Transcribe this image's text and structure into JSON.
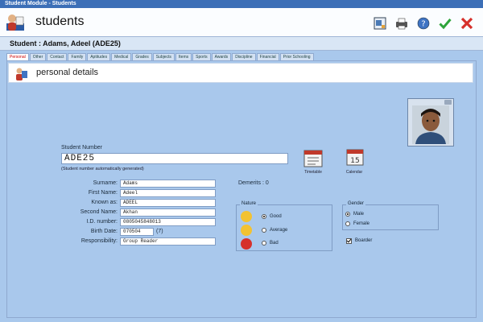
{
  "window": {
    "title": "Student Module - Students"
  },
  "header": {
    "title": "students"
  },
  "student": {
    "heading": "Student : Adams, Adeel (ADE25)"
  },
  "tabs": [
    {
      "label": "Personal"
    },
    {
      "label": "Other"
    },
    {
      "label": "Contact"
    },
    {
      "label": "Family"
    },
    {
      "label": "Aptitudes"
    },
    {
      "label": "Medical"
    },
    {
      "label": "Grades"
    },
    {
      "label": "Subjects"
    },
    {
      "label": "Items"
    },
    {
      "label": "Sports"
    },
    {
      "label": "Awards"
    },
    {
      "label": "Discipline"
    },
    {
      "label": "Financial"
    },
    {
      "label": "Prior Schooling"
    }
  ],
  "section": {
    "title": "personal details"
  },
  "student_number": {
    "label": "Student Number",
    "value": "ADE25",
    "hint": "(Student number automatically generated)"
  },
  "buttons": {
    "timetable": "Timetable",
    "calendar": "Calendar"
  },
  "fields": [
    {
      "label": "Surname:",
      "value": "Adams"
    },
    {
      "label": "First Name:",
      "value": "Adeel"
    },
    {
      "label": "Known as:",
      "value": "ADEEL"
    },
    {
      "label": "Second Name:",
      "value": "Akhan"
    },
    {
      "label": "I.D. number:",
      "value": "0805045848013"
    },
    {
      "label": "Birth Date:",
      "value": "070504",
      "extra": "(7)"
    },
    {
      "label": "Responsibility:",
      "value": "Group Reader"
    }
  ],
  "demerits": "Demerits : 0",
  "nature": {
    "title": "Nature",
    "options": [
      {
        "label": "Good",
        "selected": true
      },
      {
        "label": "Average",
        "selected": false
      },
      {
        "label": "Bad",
        "selected": false
      }
    ]
  },
  "gender": {
    "title": "Gender",
    "options": [
      {
        "label": "Male",
        "selected": true
      },
      {
        "label": "Female",
        "selected": false
      }
    ]
  },
  "boarder": {
    "label": "Boarder",
    "checked": true
  },
  "colors": {
    "background": "#a9c8ec",
    "titlebar": "#3c6fb7",
    "active_tab_text": "#cc0000"
  }
}
